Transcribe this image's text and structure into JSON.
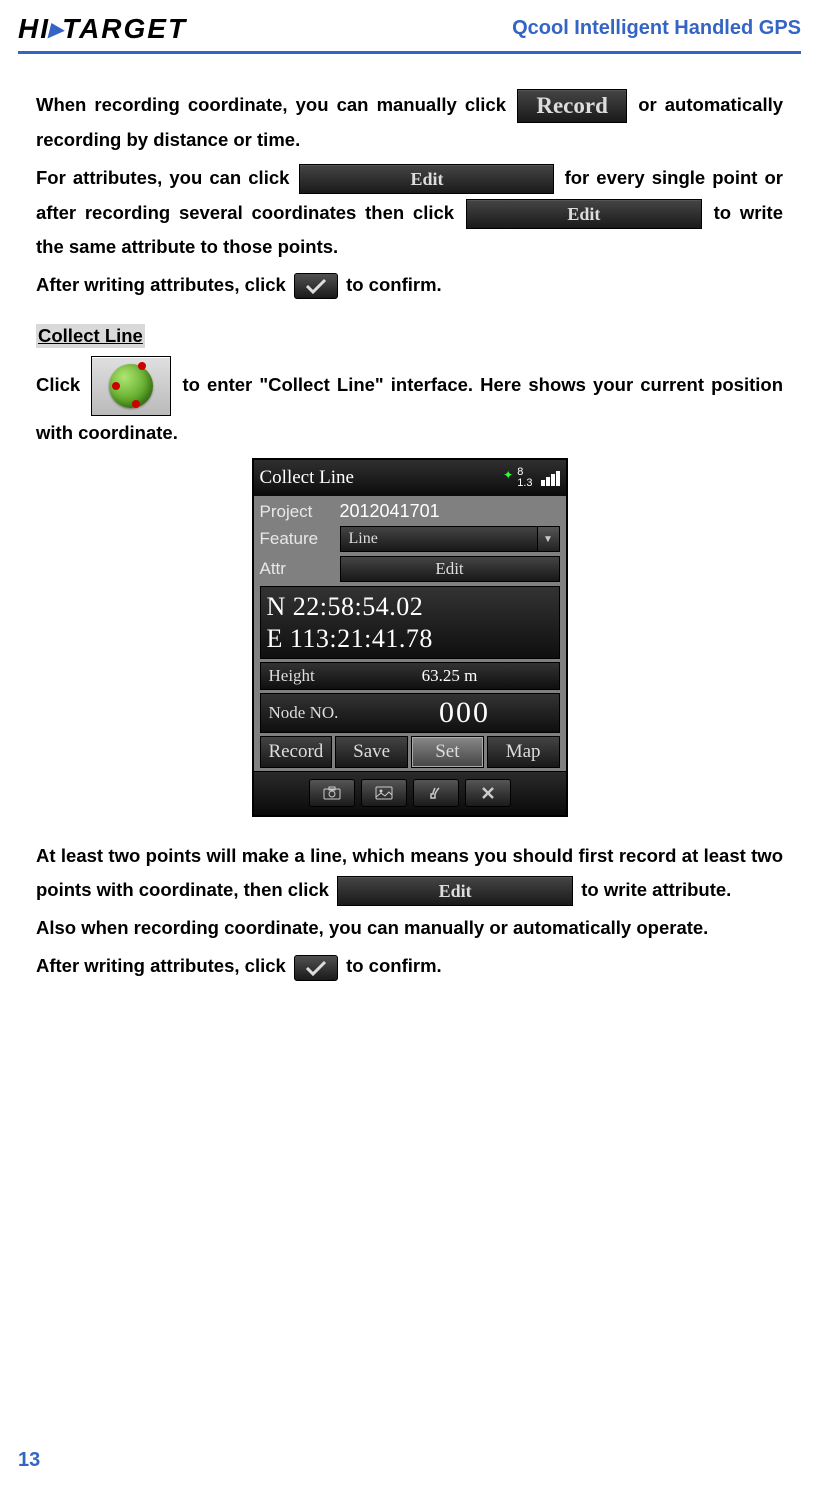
{
  "header": {
    "logo_hi": "HI",
    "logo_target": "TARGET",
    "title": "Qcool Intelligent Handled GPS"
  },
  "buttons": {
    "record": "Record",
    "edit": "Edit"
  },
  "body": {
    "p1a": "When recording coordinate, you can manually click ",
    "p1b": " or automatically recording by distance or time.",
    "p2a": "For attributes, you can click ",
    "p2b": " for every single point or after recording several coordinates then click ",
    "p2c": " to write the same attribute to those points.",
    "p3a": "After writing attributes, click ",
    "p3b": " to confirm."
  },
  "section_heading": "Collect Line",
  "collect": {
    "p1a": "Click ",
    "p1b": " to enter \"Collect Line\" interface. Here shows your current position with coordinate."
  },
  "screenshot": {
    "title": "Collect Line",
    "sat_top": "8",
    "sat_bottom": "1.3",
    "rows": {
      "project_label": "Project",
      "project_value": "2012041701",
      "feature_label": "Feature",
      "feature_value": "Line",
      "attr_label": "Attr",
      "attr_button": "Edit"
    },
    "coord": {
      "north": "N   22:58:54.02",
      "east": "E 113:21:41.78"
    },
    "height_label": "Height",
    "height_value": "63.25 m",
    "node_label": "Node NO.",
    "node_value": "000",
    "buttons": [
      "Record",
      "Save",
      "Set",
      "Map"
    ]
  },
  "after": {
    "p1a": "At least two points will make a line, which means you should first record at least two points with coordinate, then click ",
    "p1b": " to write attribute.",
    "p2": "Also when recording coordinate, you can manually or automatically operate.",
    "p3a": "After writing attributes, click ",
    "p3b": " to confirm."
  },
  "page_number": "13"
}
